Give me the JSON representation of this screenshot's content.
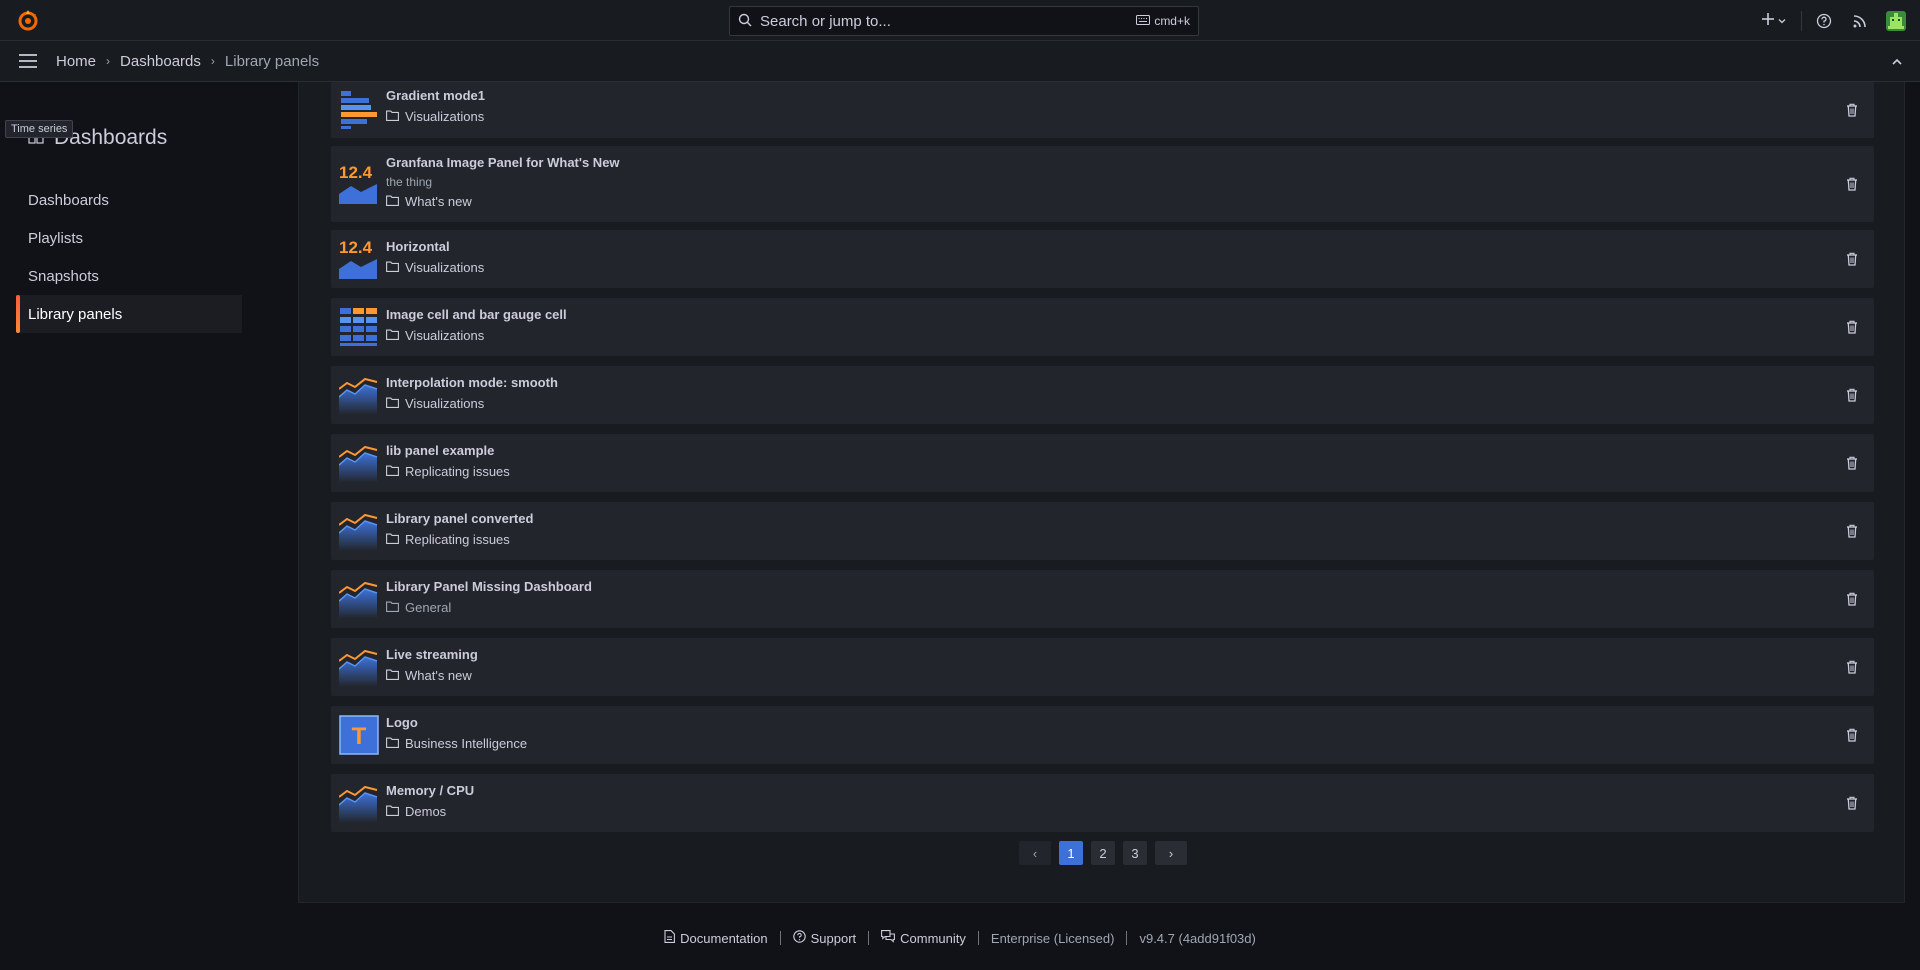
{
  "topbar": {
    "search_placeholder": "Search or jump to...",
    "search_shortcut": "cmd+k",
    "icons": [
      "grafana-logo-icon",
      "search-icon",
      "keyboard-icon",
      "plus-icon",
      "chevron-down-icon",
      "help-icon",
      "rss-icon",
      "user-avatar-icon"
    ]
  },
  "breadcrumb": {
    "items": [
      "Home",
      "Dashboards",
      "Library panels"
    ]
  },
  "sidebar": {
    "tooltip": "Time series",
    "title": "Dashboards",
    "items": [
      {
        "label": "Dashboards"
      },
      {
        "label": "Playlists"
      },
      {
        "label": "Snapshots"
      },
      {
        "label": "Library panels",
        "active": true
      }
    ]
  },
  "panels": [
    {
      "title": "Gradient mode1",
      "description": "",
      "folder": "Visualizations",
      "icon": "bar-gauge-icon"
    },
    {
      "title": "Granfana Image Panel for What's New",
      "description": "the thing",
      "folder": "What's new",
      "icon": "stat-icon",
      "stat_text": "12.4"
    },
    {
      "title": "Horizontal",
      "description": "",
      "folder": "Visualizations",
      "icon": "stat-icon",
      "stat_text": "12.4"
    },
    {
      "title": "Image cell and bar gauge cell",
      "description": "",
      "folder": "Visualizations",
      "icon": "table-icon"
    },
    {
      "title": "Interpolation mode: smooth",
      "description": "",
      "folder": "Visualizations",
      "icon": "timeseries-icon"
    },
    {
      "title": "lib panel example",
      "description": "",
      "folder": "Replicating issues",
      "icon": "timeseries-icon"
    },
    {
      "title": "Library panel converted",
      "description": "",
      "folder": "Replicating issues",
      "icon": "timeseries-icon"
    },
    {
      "title": "Library Panel Missing Dashboard",
      "description": "",
      "folder": "General",
      "icon": "timeseries-icon",
      "folder_muted": true
    },
    {
      "title": "Live streaming",
      "description": "",
      "folder": "What's new",
      "icon": "timeseries-icon"
    },
    {
      "title": "Logo",
      "description": "",
      "folder": "Business Intelligence",
      "icon": "text-icon",
      "text_glyph": "T"
    },
    {
      "title": "Memory / CPU",
      "description": "",
      "folder": "Demos",
      "icon": "timeseries-icon"
    }
  ],
  "pagination": {
    "pages": [
      "1",
      "2",
      "3"
    ],
    "current": "1",
    "prev": "‹",
    "next": "›"
  },
  "footer": {
    "documentation": "Documentation",
    "support": "Support",
    "community": "Community",
    "edition": "Enterprise (Licensed)",
    "version": "v9.4.7 (4add91f03d)"
  },
  "colors": {
    "accent_blue": "#3d71d9",
    "accent_orange": "#ff9830",
    "active_bar": "#f55f3e"
  }
}
